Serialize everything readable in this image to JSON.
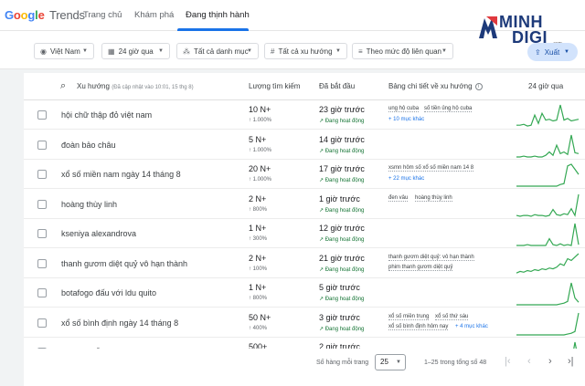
{
  "app": {
    "logo_google": "Google",
    "logo_trends": "Trends"
  },
  "nav": {
    "tabs": [
      {
        "label": "Trang chủ"
      },
      {
        "label": "Khám phá"
      },
      {
        "label": "Đang thịnh hành"
      }
    ]
  },
  "brand": {
    "line1": "MINH",
    "line2": "DIGI",
    "domain": ".com"
  },
  "filters": {
    "country": "Việt Nam",
    "time": "24 giờ qua",
    "category": "Tất cả danh mục",
    "trend_type": "Tất cả xu hướng",
    "sort": "Theo mức độ liên quan"
  },
  "export": {
    "label": "Xuất"
  },
  "table": {
    "headers": {
      "trend": "Xu hướng",
      "trend_note": "(Đã cập nhật vào 10:01, 15 thg 8)",
      "volume": "Lượng tìm kiếm",
      "started": "Đã bắt đầu",
      "breakdown": "Bảng chi tiết về xu hướng",
      "chart": "24 giờ qua"
    },
    "rows": [
      {
        "term": "hội chữ thập đỏ việt nam",
        "volume": "10 N+",
        "pct": "↑ 1.000%",
        "started": "23 giờ trước",
        "status": "↗ Đang hoạt động",
        "breakdown": [
          "ung hộ cuba",
          "số tiền ủng hộ cuba"
        ],
        "more": "+ 10 mục khác",
        "spark": [
          2,
          2,
          3,
          1,
          2,
          14,
          4,
          16,
          8,
          9,
          7,
          8,
          26,
          8,
          10,
          7,
          8,
          9
        ]
      },
      {
        "term": "đoàn bảo châu",
        "volume": "5 N+",
        "pct": "↑ 1.000%",
        "started": "14 giờ trước",
        "status": "↗ Đang hoạt động",
        "breakdown": [],
        "more": "",
        "spark": [
          0,
          0,
          1,
          0,
          0,
          1,
          0,
          0,
          2,
          6,
          2,
          14,
          4,
          6,
          3,
          26,
          5,
          4
        ]
      },
      {
        "term": "xổ số miền nam ngày 14 tháng 8",
        "volume": "20 N+",
        "pct": "↑ 1.000%",
        "started": "17 giờ trước",
        "status": "↗ Đang hoạt động",
        "breakdown": [
          "xsmn hôm số xổ số miền nam 14 8"
        ],
        "more": "+ 22 mục khác",
        "spark": [
          0,
          0,
          0,
          0,
          0,
          0,
          0,
          0,
          0,
          0,
          0,
          0,
          2,
          3,
          24,
          26,
          20,
          14
        ]
      },
      {
        "term": "hoàng thùy linh",
        "volume": "2 N+",
        "pct": "↑ 800%",
        "started": "1 giờ trước",
        "status": "↗ Đang hoạt động",
        "breakdown": [
          "đen vâu",
          "hoàng thùy linh"
        ],
        "more": "",
        "spark": [
          1,
          0,
          1,
          1,
          0,
          2,
          1,
          1,
          0,
          1,
          8,
          2,
          1,
          3,
          2,
          9,
          1,
          26
        ]
      },
      {
        "term": "kseniya alexandrova",
        "volume": "1 N+",
        "pct": "↑ 300%",
        "started": "12 giờ trước",
        "status": "↗ Đang hoạt động",
        "breakdown": [],
        "more": "",
        "spark": [
          0,
          0,
          0,
          1,
          0,
          0,
          0,
          0,
          0,
          8,
          1,
          0,
          2,
          0,
          1,
          0,
          26,
          1
        ]
      },
      {
        "term": "thanh gươm diệt quỷ vô hạn thành",
        "volume": "2 N+",
        "pct": "↑ 100%",
        "started": "21 giờ trước",
        "status": "↗ Đang hoạt động",
        "breakdown": [
          "thanh gươm diệt quỷ: vô hạn thành",
          "phim thanh gươm diệt quỷ"
        ],
        "more": "",
        "spark": [
          3,
          5,
          4,
          6,
          5,
          7,
          6,
          8,
          7,
          9,
          8,
          10,
          14,
          12,
          20,
          18,
          22,
          26
        ]
      },
      {
        "term": "botafogo đấu với ldu quito",
        "volume": "1 N+",
        "pct": "↑ 800%",
        "started": "5 giờ trước",
        "status": "↗ Đang hoạt động",
        "breakdown": [],
        "more": "",
        "spark": [
          0,
          0,
          0,
          0,
          0,
          0,
          0,
          0,
          0,
          0,
          0,
          0,
          1,
          2,
          4,
          26,
          8,
          3
        ]
      },
      {
        "term": "xổ số bình định ngày 14 tháng 8",
        "volume": "50 N+",
        "pct": "↑ 400%",
        "started": "3 giờ trước",
        "status": "↗ Đang hoạt động",
        "breakdown": [
          "xổ số miền trung",
          "xổ số thứ sáu",
          "xổ số bình định hôm nay"
        ],
        "more": "+ 4 mục khác",
        "spark": [
          0,
          0,
          0,
          0,
          0,
          0,
          0,
          0,
          0,
          0,
          0,
          0,
          0,
          0,
          1,
          2,
          4,
          26
        ]
      },
      {
        "term": "linh nghỉ lễ",
        "volume": "500+",
        "pct": "",
        "started": "2 giờ trước",
        "status": "",
        "breakdown": [],
        "more": "",
        "spark": [
          0,
          0,
          0,
          0,
          0,
          0,
          0,
          0,
          0,
          0,
          0,
          0,
          0,
          0,
          0,
          1,
          26,
          4
        ]
      }
    ]
  },
  "footer": {
    "rows_label": "Số hàng mỗi trang",
    "rows_value": "25",
    "range": "1–25 trong tổng số 48"
  },
  "colors": {
    "accent": "#1a73e8",
    "spark": "#34a853",
    "active_status": "#137333"
  }
}
